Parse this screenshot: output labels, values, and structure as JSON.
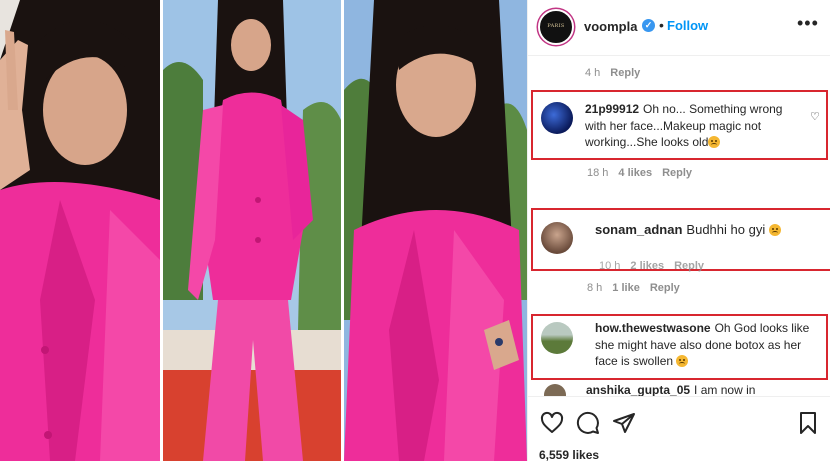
{
  "post": {
    "username": "voompla",
    "verified_mark": "✓",
    "follow_label": "Follow",
    "more_label": "•••",
    "avatar_text": "PARIS",
    "likes": "6,559 likes"
  },
  "comments": [
    {
      "time": "4 h",
      "reply": "Reply"
    },
    {
      "user": "21p99912",
      "text": "Oh no... Something wrong with her face...Makeup magic not working...She looks old",
      "emoji": "sad-face-emoji",
      "time": "18 h",
      "likes": "4 likes",
      "reply": "Reply"
    },
    {
      "user": "sonam_adnan",
      "text": "Budhhi ho gyi",
      "emoji": "laughing-emoji",
      "time": "10 h",
      "likes": "2 likes",
      "reply": "Reply"
    },
    {
      "time": "8 h",
      "likes": "1 like",
      "reply": "Reply"
    },
    {
      "user": "how.thewestwasone",
      "text": "Oh God looks like she might have also done botox as her face is swollen",
      "emoji": "laughing-emoji"
    },
    {
      "user": "anshika_gupta_05",
      "text": "I am now in"
    }
  ],
  "icons": [
    "heart-icon",
    "comment-icon",
    "share-icon",
    "bookmark-icon"
  ],
  "colors": {
    "accent": "#0095f6",
    "highlight_box": "#d8262f",
    "suit_pink": "#ee2d9a"
  }
}
